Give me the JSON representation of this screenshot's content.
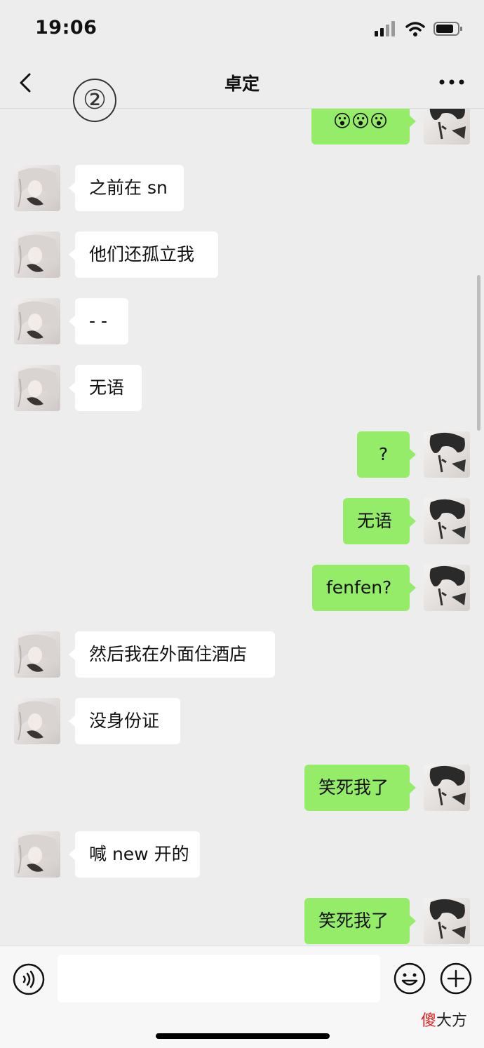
{
  "status_bar": {
    "time": "19:06"
  },
  "header": {
    "title": "卓定",
    "badge": "②"
  },
  "messages": [
    {
      "side": "out",
      "text": "😮😮😮"
    },
    {
      "side": "in",
      "text": "之前在 sn"
    },
    {
      "side": "in",
      "text": "他们还孤立我"
    },
    {
      "side": "in",
      "text": "- -"
    },
    {
      "side": "in",
      "text": "无语"
    },
    {
      "side": "out",
      "text": "?"
    },
    {
      "side": "out",
      "text": "无语"
    },
    {
      "side": "out",
      "text": "fenfen?"
    },
    {
      "side": "in",
      "text": "然后我在外面住酒店"
    },
    {
      "side": "in",
      "text": "没身份证"
    },
    {
      "side": "out",
      "text": "笑死我了"
    },
    {
      "side": "in",
      "text": "喊 new 开的"
    },
    {
      "side": "out",
      "text": "笑死我了"
    }
  ],
  "input": {
    "placeholder": ""
  },
  "watermark": {
    "red": "傻",
    "rest": "大方"
  },
  "colors": {
    "sent_bubble": "#95ec69",
    "received_bubble": "#ffffff",
    "background": "#ededed"
  },
  "icons": {
    "back": "chevron-left-icon",
    "more": "more-dots-icon",
    "voice": "voice-icon",
    "emoji": "emoji-icon",
    "plus": "plus-icon",
    "signal": "signal-icon",
    "wifi": "wifi-icon",
    "battery": "battery-icon"
  }
}
